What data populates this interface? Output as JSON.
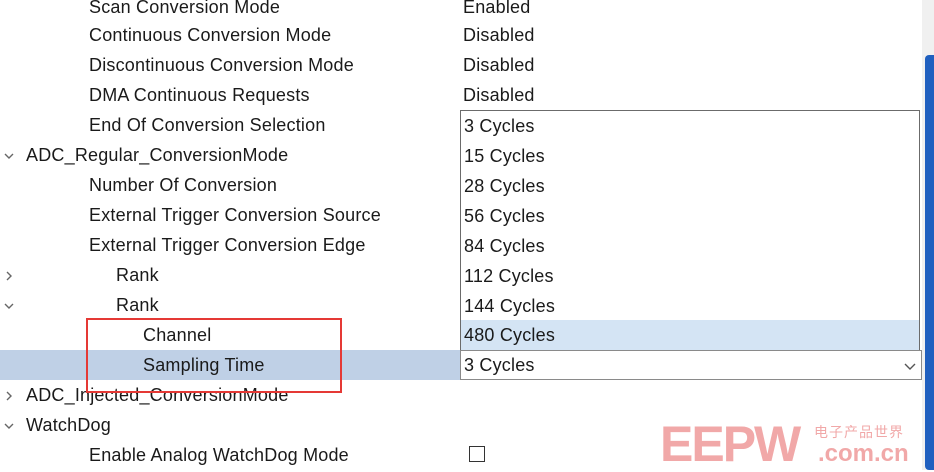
{
  "tree": {
    "rows": [
      {
        "label": "Scan Conversion Mode",
        "value": "Enabled"
      },
      {
        "label": "Continuous Conversion Mode",
        "value": "Disabled"
      },
      {
        "label": "Discontinuous Conversion Mode",
        "value": "Disabled"
      },
      {
        "label": "DMA Continuous Requests",
        "value": "Disabled"
      },
      {
        "label": "End Of Conversion Selection",
        "value": ""
      },
      {
        "label": "ADC_Regular_ConversionMode",
        "value": ""
      },
      {
        "label": "Number Of Conversion",
        "value": ""
      },
      {
        "label": "External Trigger Conversion Source",
        "value": ""
      },
      {
        "label": "External Trigger Conversion Edge",
        "value": ""
      },
      {
        "label": "Rank",
        "value": ""
      },
      {
        "label": "Rank",
        "value": ""
      },
      {
        "label": "Channel",
        "value": ""
      },
      {
        "label": "Sampling Time",
        "value": ""
      },
      {
        "label": "ADC_Injected_ConversionMode",
        "value": ""
      },
      {
        "label": "WatchDog",
        "value": ""
      },
      {
        "label": "Enable Analog WatchDog Mode",
        "value": ""
      }
    ]
  },
  "dropdown": {
    "options": [
      "3 Cycles",
      "15 Cycles",
      "28 Cycles",
      "56 Cycles",
      "84 Cycles",
      "112 Cycles",
      "144 Cycles",
      "480 Cycles"
    ],
    "highlighted": "480 Cycles",
    "selected_value": "3 Cycles"
  },
  "checkbox": {
    "checked": false
  },
  "watermark": {
    "brand": "EEPW",
    "cn_text": "电子产品世界",
    "domain_text": ".com.cn"
  },
  "colors": {
    "selection": "#bfd0e6",
    "hover": "#d4e4f4",
    "annotation": "#e53935",
    "scroll_thumb": "#1f5fbf"
  }
}
